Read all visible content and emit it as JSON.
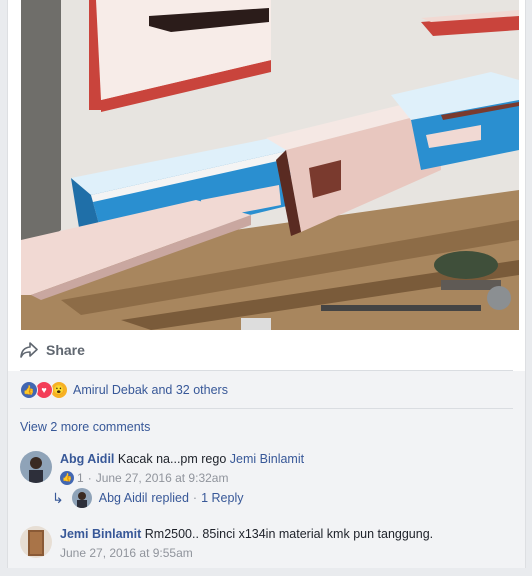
{
  "post": {
    "share_label": "Share"
  },
  "reactions": {
    "icons": [
      "like-icon",
      "love-icon",
      "wow-icon"
    ],
    "summary": "Amirul Debak and 32 others"
  },
  "view_more_comments": "View 2 more comments",
  "comments": [
    {
      "author": "Abg Aidil",
      "text": "Kacak na...pm rego",
      "mention": "Jemi Binlamit",
      "like_count": "1",
      "timestamp": "June 27, 2016 at 9:32am",
      "reply": {
        "author": "Abg Aidil",
        "action": "replied",
        "separator": "·",
        "count_label": "1 Reply"
      }
    },
    {
      "author": "Jemi Binlamit",
      "text": "Rm2500.. 85inci x134in material kmk pun tanggung.",
      "timestamp": "June 27, 2016 at 9:55am"
    }
  ],
  "colors": {
    "link": "#385898",
    "like_blue": "#4267b2",
    "love_red": "#f33e58",
    "wow_yellow": "#f7b125",
    "shelf_blue": "#2a8fd0",
    "shelf_pink": "#eccfc8",
    "trim_red": "#b8322e"
  }
}
